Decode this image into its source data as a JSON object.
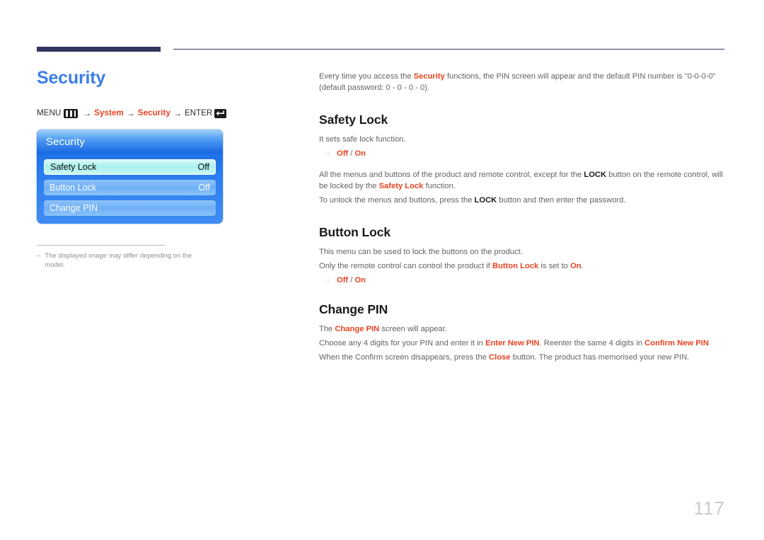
{
  "page": {
    "title": "Security",
    "number": "117"
  },
  "menu_path": {
    "menu_label": "MENU",
    "menu_icon": "menu-bars-icon",
    "arrow": "→",
    "step1": "System",
    "step2": "Security",
    "enter_label": "ENTER",
    "enter_icon": "enter-return-icon"
  },
  "osd": {
    "header": "Security",
    "rows": [
      {
        "label": "Safety Lock",
        "value": "Off",
        "selected": true
      },
      {
        "label": "Button Lock",
        "value": "Off",
        "selected": false
      },
      {
        "label": "Change PIN",
        "value": "",
        "selected": false
      }
    ]
  },
  "footnote": {
    "marker": "–",
    "text": "The displayed image may differ depending on the model."
  },
  "intro": {
    "part1": "Every time you access the ",
    "highlight": "Security",
    "part2": " functions, the PIN screen will appear and the default PIN number is \"0-0-0-0\" (default password: 0 - 0 - 0 - 0)."
  },
  "safety_lock": {
    "heading": "Safety Lock",
    "desc": "It sets safe lock function.",
    "bullet": {
      "off": "Off",
      "sep": " / ",
      "on": "On"
    },
    "para1_a": "All the menus and buttons of the product and remote control, except for the ",
    "para1_lock": "LOCK",
    "para1_b": " button on the remote control, will be locked by the ",
    "para1_c": "Safety Lock",
    "para1_d": " function.",
    "para2_a": "To unlock the menus and buttons, press the ",
    "para2_lock": "LOCK",
    "para2_b": " button and then enter the password."
  },
  "button_lock": {
    "heading": "Button Lock",
    "desc": "This menu can be used to lock the buttons on the product.",
    "para_a": "Only the remote control can control the product if ",
    "para_b": "Button Lock",
    "para_c": " is set to ",
    "para_d": "On",
    "para_e": ".",
    "bullet": {
      "off": "Off",
      "sep": " / ",
      "on": "On"
    }
  },
  "change_pin": {
    "heading": "Change PIN",
    "para1_a": "The ",
    "para1_b": "Change PIN",
    "para1_c": " screen will appear.",
    "para2_a": "Choose any 4 digits for your PIN and enter it in ",
    "para2_b": "Enter New PIN",
    "para2_c": ". Reenter the same 4 digits in ",
    "para2_d": "Confirm New PIN",
    "para3_a": "When the Confirm screen disappears, press the ",
    "para3_b": "Close",
    "para3_c": " button. The product has memorised your new PIN."
  },
  "colors": {
    "accent_blue": "#3c7ee8",
    "accent_red": "#e8431f",
    "rule_navy": "#31355f",
    "body_gray": "#636363"
  }
}
